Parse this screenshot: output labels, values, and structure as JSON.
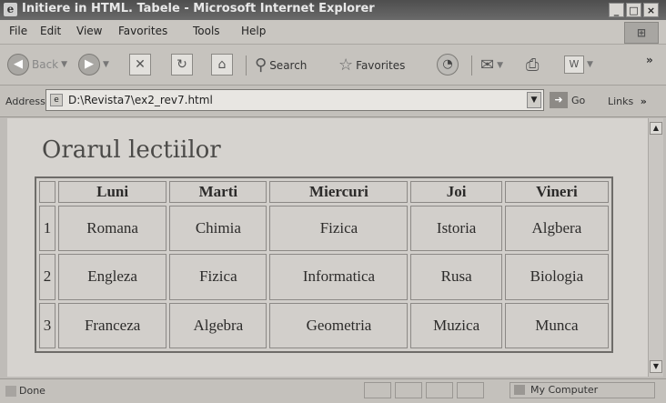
{
  "window": {
    "title": "Initiere in HTML. Tabele - Microsoft Internet Explorer",
    "controls": {
      "minimize": "_",
      "maximize": "□",
      "close": "×"
    }
  },
  "menubar": {
    "items": [
      "File",
      "Edit",
      "View",
      "Favorites",
      "Tools",
      "Help"
    ]
  },
  "toolbar": {
    "back_label": "Back",
    "search_label": "Search",
    "favorites_label": "Favorites"
  },
  "address": {
    "label": "Address",
    "value": "D:\\Revista7\\ex2_rev7.html",
    "go_label": "Go",
    "links_label": "Links"
  },
  "page": {
    "title": "Orarul lectiilor",
    "table": {
      "headers": [
        "",
        "Luni",
        "Marti",
        "Miercuri",
        "Joi",
        "Vineri"
      ],
      "rows": [
        [
          "1",
          "Romana",
          "Chimia",
          "Fizica",
          "Istoria",
          "Algbera"
        ],
        [
          "2",
          "Engleza",
          "Fizica",
          "Informatica",
          "Rusa",
          "Biologia"
        ],
        [
          "3",
          "Franceza",
          "Algebra",
          "Geometria",
          "Muzica",
          "Munca"
        ]
      ]
    }
  },
  "status": {
    "left": "Done",
    "zone": "My Computer"
  },
  "icons": [
    "ie-logo-icon",
    "back-icon",
    "forward-icon",
    "stop-icon",
    "refresh-icon",
    "home-icon",
    "search-icon",
    "favorites-star-icon",
    "history-icon",
    "mail-icon",
    "print-icon",
    "edit-icon",
    "page-icon",
    "go-arrow-icon",
    "computer-icon"
  ]
}
